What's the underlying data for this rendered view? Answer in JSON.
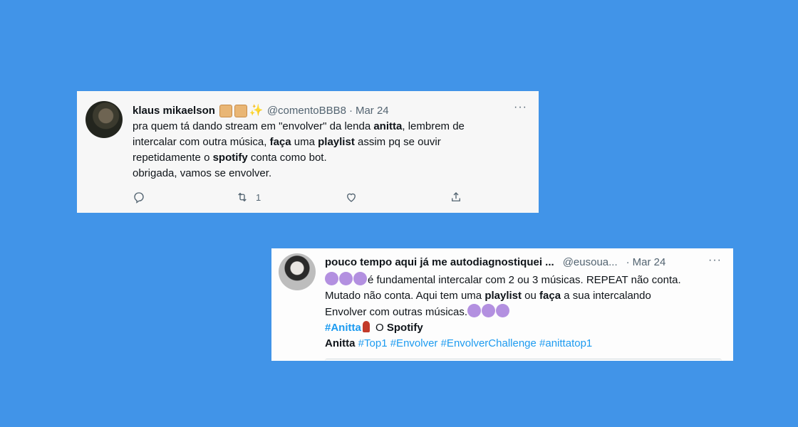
{
  "tweet1": {
    "name": "klaus mikaelson",
    "handle": "@comentoBBB8",
    "dot": "·",
    "date": "Mar 24",
    "more": "···",
    "line1": "pra quem tá dando stream em \"envolver\" da lenda ",
    "line1_bold": "anitta",
    "line1_end": ", lembrem de",
    "line2": "intercalar com outra música, ",
    "line2_bold1": "faça",
    "line2_mid": " uma ",
    "line2_bold2": "playlist",
    "line2_end": " assim pq se ouvir",
    "line3": "repetidamente o ",
    "line3_bold": "spotify",
    "line3_end": " conta como bot.",
    "line4": "obrigada, vamos se envolver.",
    "retweet_count": "1",
    "icons": [
      "reply-icon",
      "retweet-icon",
      "like-icon",
      "share-icon"
    ]
  },
  "tweet2": {
    "name": "pouco tempo aqui já me autodiagnostiquei ...",
    "handle": "@eusoua...",
    "dot": "·",
    "date": "Mar 24",
    "more": "···",
    "line1": "é fundamental intercalar com 2 ou 3 músicas. REPEAT não conta.",
    "line2": "Mutado não conta. Aqui tem uma ",
    "line2_bold1": "playlist",
    "line2_mid": " ou ",
    "line2_bold2": "faça",
    "line2_end": " a sua intercalando",
    "line3": "Envolver com outras músicas.",
    "tag_anitta": "#Anitta",
    "line4_mid": " O ",
    "line4_bold": "Spotify",
    "line5_bold": "Anitta",
    "tags": [
      "#Top1",
      "#Envolver",
      "#EnvolverChallenge",
      "#anittatop1"
    ]
  },
  "colors": {
    "background": "#4194e8",
    "hashtag": "#1d9bf0",
    "purple_circle": "#b390e0"
  }
}
